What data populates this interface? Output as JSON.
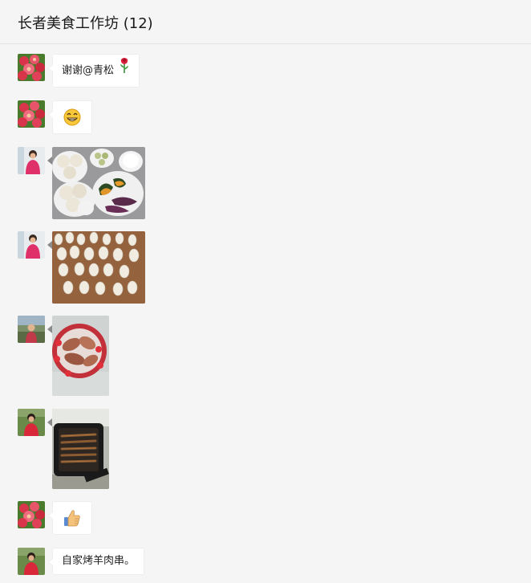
{
  "chat": {
    "title": "长者美食工作坊 (12)"
  },
  "messages": [
    {
      "kind": "text",
      "text": "谢谢@青松",
      "emoji": "rose-emoji",
      "avatar": "flowers-avatar"
    },
    {
      "kind": "emoji",
      "emoji": "grin-emoji",
      "avatar": "flowers-avatar"
    },
    {
      "kind": "image",
      "content": "buns-pumpkin-sweet-potato-photo",
      "avatar": "person-pink-avatar"
    },
    {
      "kind": "image",
      "content": "dumplings-on-board-photo",
      "avatar": "person-pink-avatar"
    },
    {
      "kind": "image",
      "content": "sweet-potatoes-bowl-photo",
      "avatar": "person-outdoor-avatar"
    },
    {
      "kind": "image",
      "content": "grill-skewers-photo",
      "avatar": "person-red-avatar"
    },
    {
      "kind": "emoji",
      "emoji": "thumbs-up-emoji",
      "avatar": "flowers-avatar"
    },
    {
      "kind": "text",
      "text": "自家烤羊肉串。",
      "avatar": "person-red-avatar"
    }
  ],
  "colors": {
    "background": "#f5f5f5",
    "bubble": "#ffffff",
    "bubble_border": "#ededed",
    "header_divider": "#e4e4e4"
  }
}
